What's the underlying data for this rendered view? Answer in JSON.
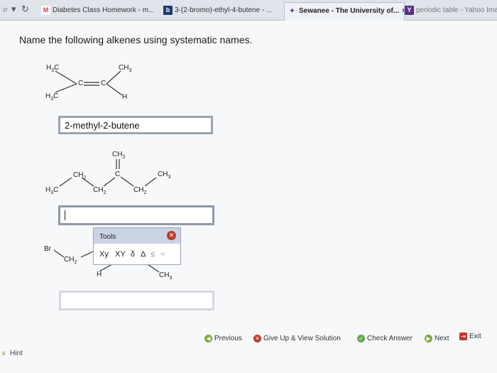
{
  "browser": {
    "tabs": [
      {
        "label": "Diabetes Class Homework - m...",
        "icon": "M",
        "icon_color": "#c44"
      },
      {
        "label": "3-(2-bromo)-ethyl-4-butene - ...",
        "icon": "b",
        "icon_color": "#1f3b6e"
      },
      {
        "label": "Sewanee - The University of...",
        "icon": "✦",
        "icon_color": "#6a2a8a",
        "close": "×"
      },
      {
        "label": "periodic table - Yahoo Ima",
        "icon": "Y",
        "icon_color": "#5a2e8c"
      }
    ]
  },
  "question": {
    "prompt": "Name the following alkenes using systematic names."
  },
  "molecule1": {
    "atoms": {
      "tl": "H3C",
      "tr": "CH3",
      "bl": "H3C",
      "br": "H",
      "c1": "C",
      "c2": "C"
    }
  },
  "answer1": {
    "value": "2-methyl-2-butene"
  },
  "molecule2": {
    "atoms": {
      "top": "CH2",
      "c": "C",
      "ch2a": "CH2",
      "ch2b": "CH2",
      "ch2c": "CH2",
      "ch3": "CH3",
      "h3c": "H3C"
    }
  },
  "answer2": {
    "value": ""
  },
  "molecule3": {
    "atoms": {
      "br": "Br",
      "ch2": "CH2",
      "h": "H",
      "ch3": "CH3"
    }
  },
  "tools": {
    "label": "Tools",
    "items": [
      "Xy",
      "XY",
      "δ",
      "Δ",
      "≤",
      "≈"
    ]
  },
  "answer3": {
    "value": ""
  },
  "footer": {
    "previous": "Previous",
    "give_up": "Give Up & View Solution",
    "check": "Check Answer",
    "next": "Next",
    "exit": "Exit",
    "hint": "Hint"
  },
  "colors": {
    "tab_bar": "#dfe3ea",
    "tools_header": "#c9d3e4",
    "close_red": "#c0392b"
  }
}
